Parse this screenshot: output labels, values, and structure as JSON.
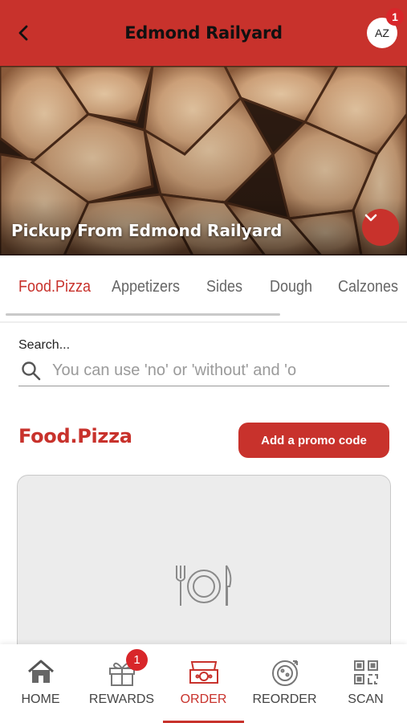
{
  "header": {
    "title": "Edmond Railyard",
    "avatar_initials": "AZ",
    "avatar_badge": "1",
    "accent_color": "#c8322c"
  },
  "hero": {
    "pickup_text": "Pickup From Edmond Railyard"
  },
  "tabs": [
    {
      "label": "Food.Pizza",
      "active": true
    },
    {
      "label": "Appetizers",
      "active": false
    },
    {
      "label": "Sides",
      "active": false
    },
    {
      "label": "Dough",
      "active": false
    },
    {
      "label": "Calzones",
      "active": false
    }
  ],
  "search": {
    "label": "Search...",
    "placeholder": "You can use 'no' or 'without' and 'o",
    "value": ""
  },
  "section": {
    "title": "Food.Pizza",
    "promo_button": "Add a promo code"
  },
  "card": {
    "icon": "plate-utensils-icon"
  },
  "bottom_nav": {
    "items": [
      {
        "label": "HOME",
        "icon": "home-icon"
      },
      {
        "label": "REWARDS",
        "icon": "gift-icon",
        "badge": "1"
      },
      {
        "label": "ORDER",
        "icon": "pizza-box-icon",
        "active": true
      },
      {
        "label": "REORDER",
        "icon": "reorder-pizza-icon"
      },
      {
        "label": "SCAN",
        "icon": "qr-code-icon"
      }
    ]
  }
}
